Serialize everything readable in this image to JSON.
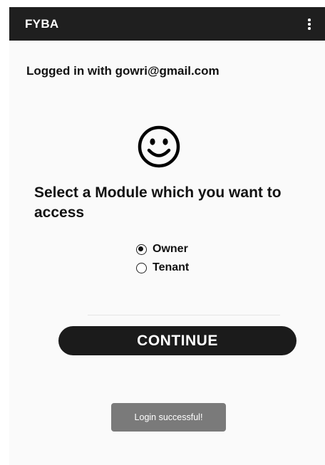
{
  "app_bar": {
    "title": "FYBA",
    "overflow_icon": "more-vert-icon"
  },
  "login_status": "Logged in with gowri@gmail.com",
  "smiley_icon": "smiley-face-icon",
  "prompt": "Select a Module which you want to access",
  "modules": [
    {
      "label": "Owner",
      "selected": true
    },
    {
      "label": "Tenant",
      "selected": false
    }
  ],
  "continue_label": "CONTINUE",
  "toast": "Login successful!",
  "colors": {
    "app_bar": "#1f1f1f",
    "button": "#1b1b1b",
    "toast": "#7a7a7a",
    "background": "#fafafa"
  }
}
